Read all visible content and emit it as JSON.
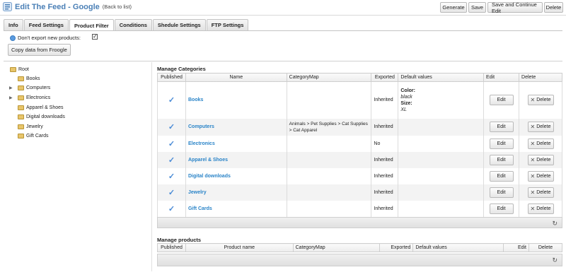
{
  "header": {
    "title": "Edit The Feed - Google",
    "back_link": "(Back to list)",
    "buttons": [
      "Generate",
      "Save",
      "Save and Continue Edit",
      "Delete"
    ]
  },
  "tabs": [
    "Info",
    "Feed Settings",
    "Product Filter",
    "Conditions",
    "Shedule Settings",
    "FTP Settings"
  ],
  "active_tab": "Product Filter",
  "options": {
    "dont_export_label": "Don't export new products:",
    "dont_export_checked": true,
    "copy_button": "Copy data from Froogle"
  },
  "tree": {
    "root": "Root",
    "items": [
      "Books",
      "Computers",
      "Electronics",
      "Apparel & Shoes",
      "Digital downloads",
      "Jewelry",
      "Gift Cards"
    ]
  },
  "categories": {
    "title": "Manage Categories",
    "columns": [
      "Published",
      "Name",
      "CategoryMap",
      "Exported",
      "Default values",
      "Edit",
      "Delete"
    ],
    "rows": [
      {
        "name": "Books",
        "map": "",
        "exported": "Inherited",
        "dv_color_label": "Color:",
        "dv_color": "black",
        "dv_size_label": "Size:",
        "dv_size": "XL"
      },
      {
        "name": "Computers",
        "map": "Animals > Pet Supplies > Cat Supplies > Cat Apparel",
        "exported": "Inherited"
      },
      {
        "name": "Electronics",
        "map": "",
        "exported": "No"
      },
      {
        "name": "Apparel & Shoes",
        "map": "",
        "exported": "Inherited"
      },
      {
        "name": "Digital downloads",
        "map": "",
        "exported": "Inherited"
      },
      {
        "name": "Jewelry",
        "map": "",
        "exported": "Inherited"
      },
      {
        "name": "Gift Cards",
        "map": "",
        "exported": "Inherited"
      }
    ],
    "edit_label": "Edit",
    "delete_label": "Delete"
  },
  "products": {
    "title": "Manage products",
    "columns": [
      "Published",
      "Product name",
      "CategoryMap",
      "Exported",
      "Default values",
      "Edit",
      "Delete"
    ]
  },
  "colors": {
    "accent": "#4a7fb6",
    "link": "#2a84c8",
    "check": "#4a8bd6"
  }
}
